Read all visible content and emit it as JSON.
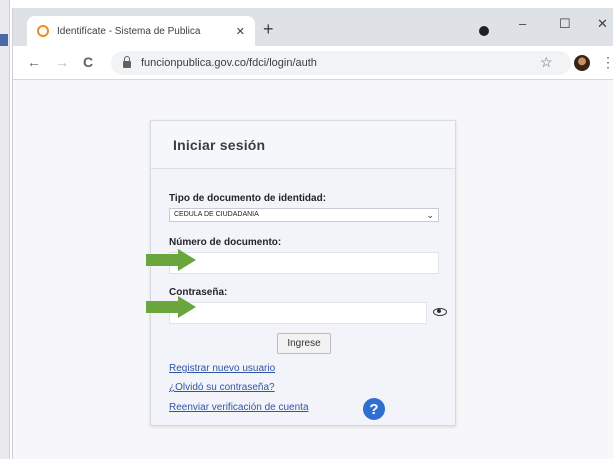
{
  "browser": {
    "tab_title": "Identifícate - Sistema de Publica",
    "tab_close": "✕",
    "new_tab": "+",
    "window_controls": {
      "minimize": "–",
      "maximize": "☐",
      "close": "✕"
    },
    "nav": {
      "back": "←",
      "forward": "→",
      "reload": "C"
    },
    "url": "funcionpublica.gov.co/fdci/login/auth",
    "icons": [
      "favicon-icon",
      "lock-icon",
      "star-icon",
      "profile-avatar",
      "kebab-menu-icon",
      "record-dot-icon"
    ],
    "bookmark_star": "☆",
    "menu": "⋮"
  },
  "login": {
    "title": "Iniciar sesión",
    "doc_type_label": "Tipo de documento de identidad:",
    "doc_type_value": "CEDULA DE CIUDADANIA",
    "doc_number_label": "Número de documento:",
    "password_label": "Contraseña:",
    "submit_label": "Ingrese",
    "register_link": "Registrar nuevo usuario",
    "forgot_link": "¿Olvidó su contraseña?",
    "resend_link": "Reenviar verificación de cuenta",
    "help_glyph": "?"
  },
  "colors": {
    "arrow": "#6aa63d",
    "link": "#2f56a6",
    "help_badge": "#2e6fd0",
    "favicon": "#f08a24"
  }
}
